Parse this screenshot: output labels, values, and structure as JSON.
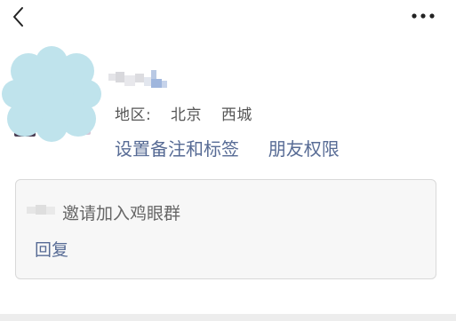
{
  "header": {
    "back_icon": "chevron-left-icon",
    "more_icon": "more-dots-icon"
  },
  "profile": {
    "region_label": "地区:",
    "region_city": "北京",
    "region_district": "西城",
    "set_remark_label": "设置备注和标签",
    "friend_permission_label": "朋友权限"
  },
  "request_card": {
    "message": "邀请加入鸡眼群",
    "reply_label": "回复"
  },
  "colors": {
    "link": "#576b95",
    "avatar_blur": "#bfe3ec",
    "card_bg": "#f7f7f7"
  }
}
